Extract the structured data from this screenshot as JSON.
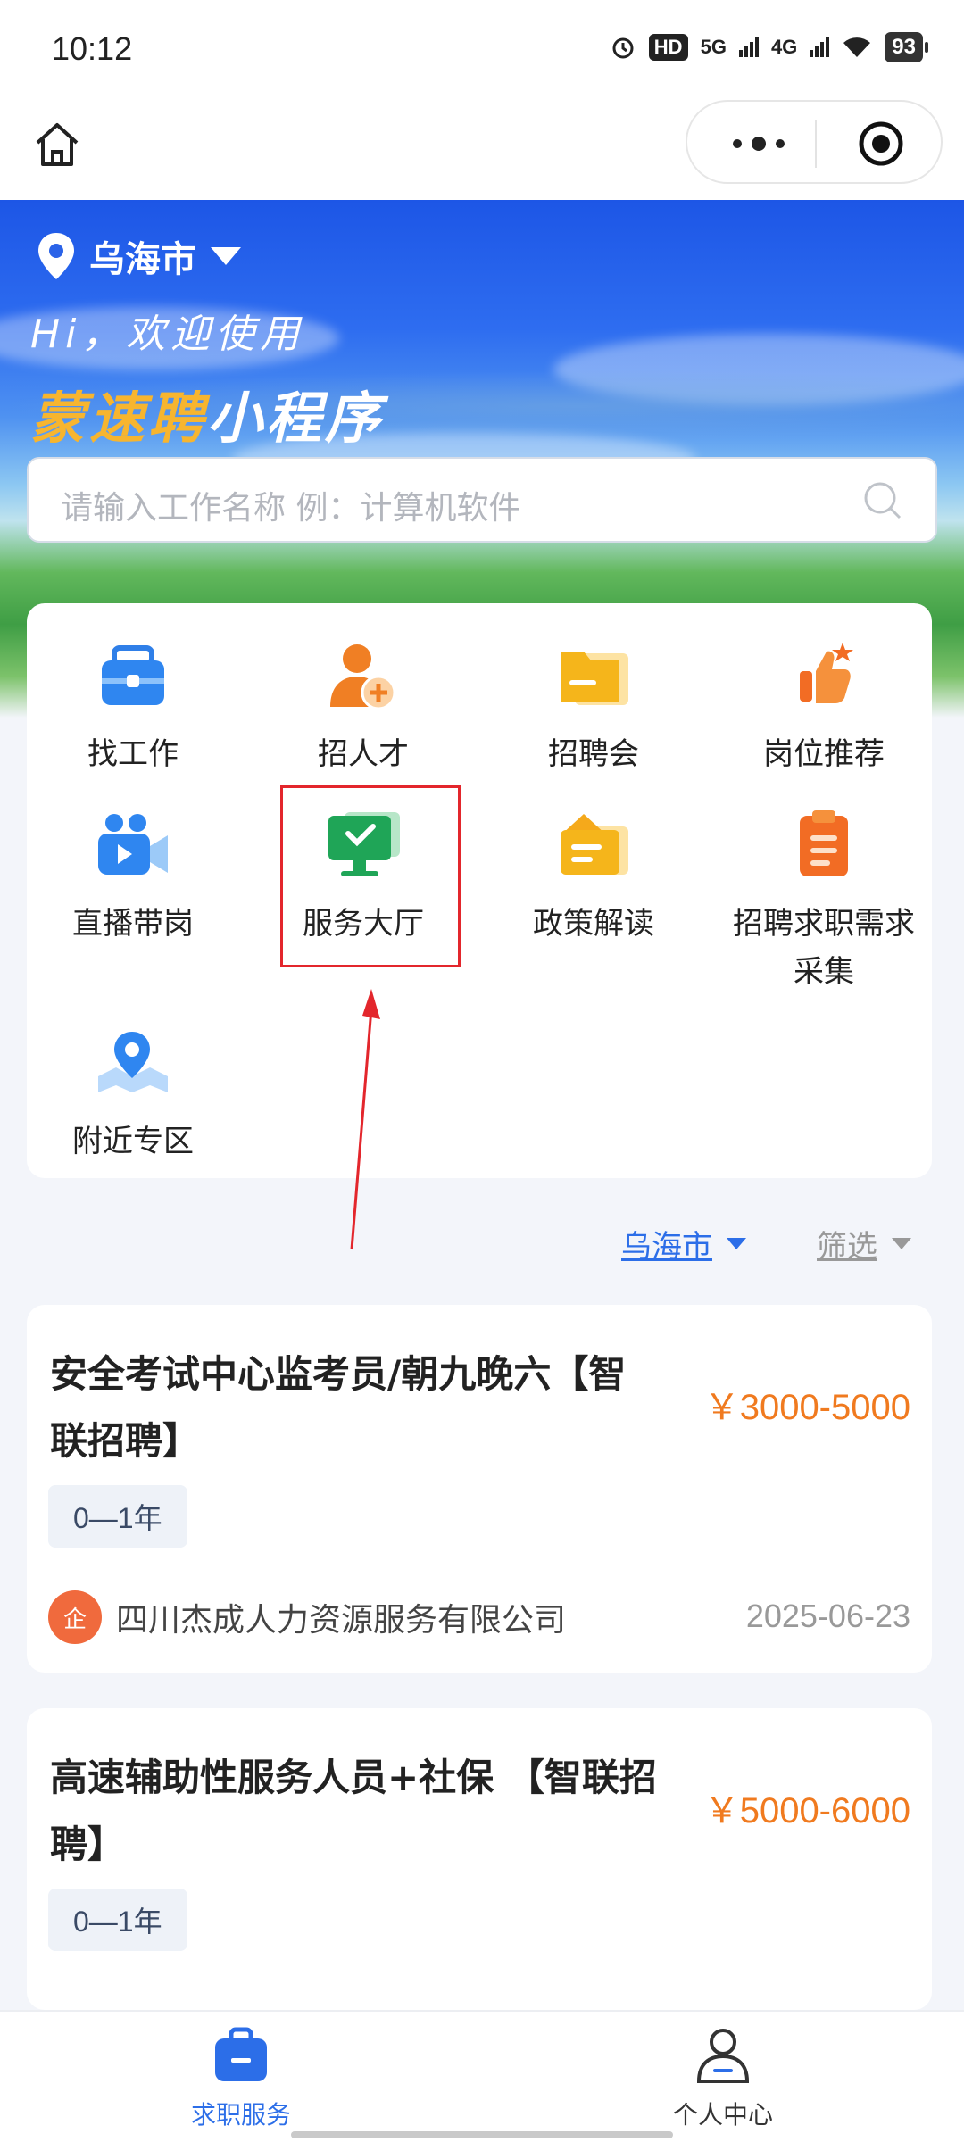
{
  "status_bar": {
    "time": "10:12",
    "hd": "HD",
    "net1": "5G",
    "net2": "4G",
    "battery": "93"
  },
  "header": {
    "location": "乌海市",
    "greeting": "Hi，欢迎使用",
    "brand_a": "蒙速聘",
    "brand_b": "小程序",
    "search_placeholder": "请输入工作名称  例：计算机软件"
  },
  "grid": [
    {
      "label": "找工作",
      "icon": "briefcase-icon"
    },
    {
      "label": "招人才",
      "icon": "add-person-icon"
    },
    {
      "label": "招聘会",
      "icon": "folder-icon"
    },
    {
      "label": "岗位推荐",
      "icon": "thumbs-up-icon"
    },
    {
      "label": "直播带岗",
      "icon": "video-camera-icon"
    },
    {
      "label": "服务大厅",
      "icon": "monitor-check-icon"
    },
    {
      "label": "政策解读",
      "icon": "document-folder-icon"
    },
    {
      "label": "招聘求职需求采集",
      "icon": "clipboard-icon"
    },
    {
      "label": "附近专区",
      "icon": "map-pin-icon"
    }
  ],
  "filter": {
    "city": "乌海市",
    "select": "筛选"
  },
  "jobs": [
    {
      "title": "安全考试中心监考员/朝九晚六【智联招聘】",
      "salary": "￥3000-5000",
      "experience": "0—1年",
      "company_badge": "企",
      "company": "四川杰成人力资源服务有限公司",
      "date": "2025-06-23"
    },
    {
      "title": "高速辅助性服务人员+社保 【智联招聘】",
      "salary": "￥5000-6000",
      "experience": "0—1年"
    }
  ],
  "tabs": [
    {
      "label": "求职服务",
      "icon": "briefcase-icon",
      "active": true
    },
    {
      "label": "个人中心",
      "icon": "person-icon",
      "active": false
    }
  ],
  "colors": {
    "primary": "#2c6ee8",
    "salary": "#f07a1f",
    "highlight": "#e3262c",
    "brand_gold": "#f7b52f"
  }
}
